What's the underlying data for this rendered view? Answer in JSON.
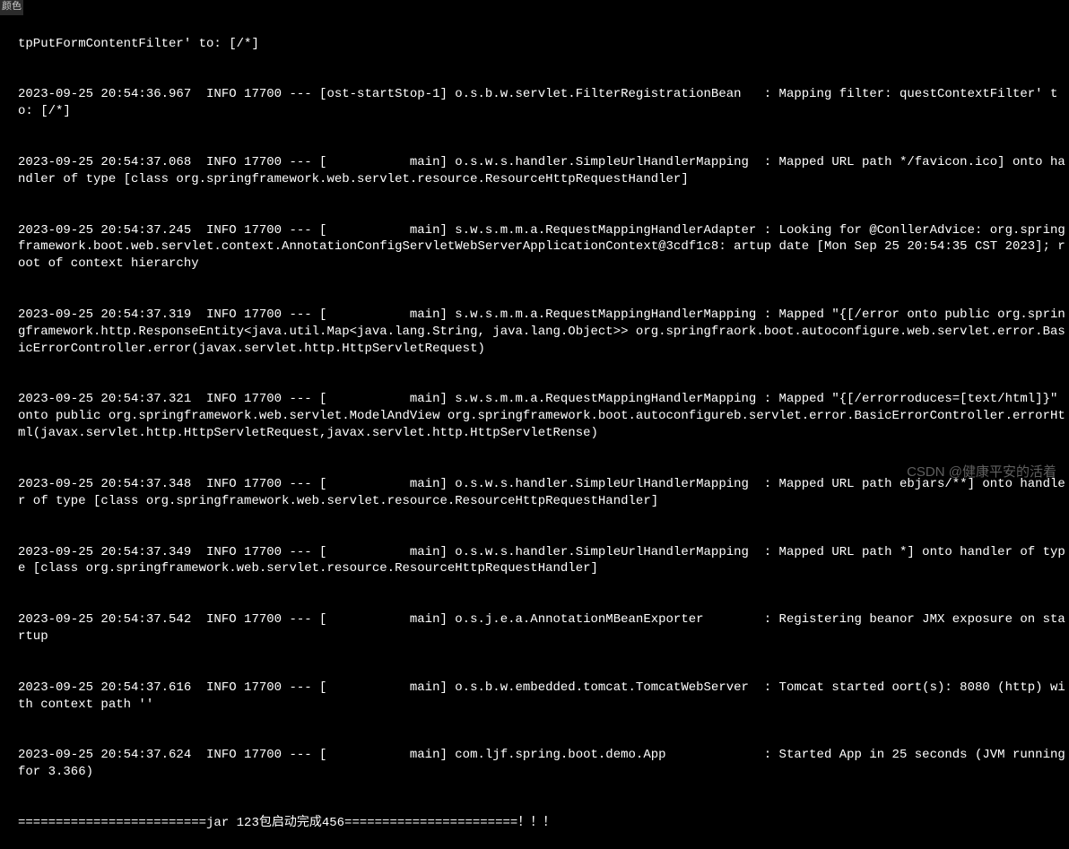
{
  "side_label": "颜色",
  "watermark": "CSDN @健康平安的活着",
  "log_lines": [
    "tpPutFormContentFilter' to: [/*]",
    "2023-09-25 20:54:36.967  INFO 17700 --- [ost-startStop-1] o.s.b.w.servlet.FilterRegistrationBean   : Mapping filter: questContextFilter' to: [/*]",
    "2023-09-25 20:54:37.068  INFO 17700 --- [           main] o.s.w.s.handler.SimpleUrlHandlerMapping  : Mapped URL path */favicon.ico] onto handler of type [class org.springframework.web.servlet.resource.ResourceHttpRequestHandler]",
    "2023-09-25 20:54:37.245  INFO 17700 --- [           main] s.w.s.m.m.a.RequestMappingHandlerAdapter : Looking for @ConllerAdvice: org.springframework.boot.web.servlet.context.AnnotationConfigServletWebServerApplicationContext@3cdf1c8: artup date [Mon Sep 25 20:54:35 CST 2023]; root of context hierarchy",
    "2023-09-25 20:54:37.319  INFO 17700 --- [           main] s.w.s.m.m.a.RequestMappingHandlerMapping : Mapped \"{[/error onto public org.springframework.http.ResponseEntity<java.util.Map<java.lang.String, java.lang.Object>> org.springfraork.boot.autoconfigure.web.servlet.error.BasicErrorController.error(javax.servlet.http.HttpServletRequest)",
    "2023-09-25 20:54:37.321  INFO 17700 --- [           main] s.w.s.m.m.a.RequestMappingHandlerMapping : Mapped \"{[/errorroduces=[text/html]}\" onto public org.springframework.web.servlet.ModelAndView org.springframework.boot.autoconfigureb.servlet.error.BasicErrorController.errorHtml(javax.servlet.http.HttpServletRequest,javax.servlet.http.HttpServletRense)",
    "2023-09-25 20:54:37.348  INFO 17700 --- [           main] o.s.w.s.handler.SimpleUrlHandlerMapping  : Mapped URL path ebjars/**] onto handler of type [class org.springframework.web.servlet.resource.ResourceHttpRequestHandler]",
    "2023-09-25 20:54:37.349  INFO 17700 --- [           main] o.s.w.s.handler.SimpleUrlHandlerMapping  : Mapped URL path *] onto handler of type [class org.springframework.web.servlet.resource.ResourceHttpRequestHandler]",
    "2023-09-25 20:54:37.542  INFO 17700 --- [           main] o.s.j.e.a.AnnotationMBeanExporter        : Registering beanor JMX exposure on startup",
    "2023-09-25 20:54:37.616  INFO 17700 --- [           main] o.s.b.w.embedded.tomcat.TomcatWebServer  : Tomcat started oort(s): 8080 (http) with context path ''",
    "2023-09-25 20:54:37.624  INFO 17700 --- [           main] com.ljf.spring.boot.demo.App             : Started App in 25 seconds (JVM running for 3.366)",
    "=========================jar 123包启动完成456=======================！！！"
  ]
}
